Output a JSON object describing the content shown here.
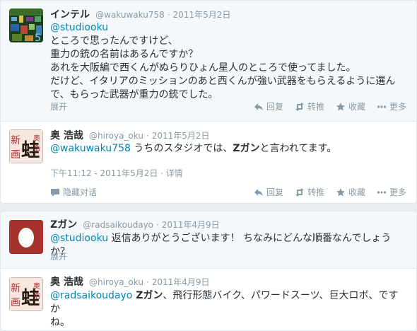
{
  "tweets": [
    {
      "name": "インテル",
      "handle": "@wakuwaku758",
      "date": "· 2011年5月2日",
      "mention": "@studiooku",
      "lines": [
        "ところで思ったんですけど、",
        "重力の銃の名前はあるんですか？",
        "あれを大阪編で西くんがぬらりひょん星人のところで使ってました。",
        "だけど、イタリアのミッションのあと西くんが強い武器をもらえるように選ん",
        "で、もらった武器が重力の銃でした。"
      ],
      "expand": "展开"
    },
    {
      "name": "奥 浩哉",
      "handle": "@hiroya_oku",
      "date": "· 2011年5月2日",
      "mention": "@wakuwaku758",
      "body_pre": " うちのスタジオでは、",
      "body_bold": "Zガン",
      "body_post": "と言われてます。",
      "timestamp": "下午11:12 - 2011年5月2日 · 详情",
      "hide": "隐藏对话"
    },
    {
      "name": "Zガン",
      "handle": "@radsaikoudayo",
      "date": "· 2011年4月9日",
      "mention": "@studiooku",
      "body": " 返信ありがとうございます！ ちなみにどんな順番なんでしょうか？",
      "expand": "展开"
    },
    {
      "name": "奥 浩哉",
      "handle": "@hiroya_oku",
      "date": "· 2011年4月9日",
      "mention": "@radsaikoudayo",
      "body_bold": " Zガン",
      "body_line1": "、飛行形態バイク、パワードスーツ、巨大ロボ、ですか",
      "body_line2": "ね。"
    }
  ],
  "actions": {
    "reply": "回复",
    "retweet": "转推",
    "favorite": "收藏",
    "more": "更多"
  },
  "colors": {
    "link": "#0084b4",
    "muted": "#8899a6",
    "text": "#292f33",
    "border": "#e1e8ed",
    "avatar_red": "#a7312d"
  }
}
